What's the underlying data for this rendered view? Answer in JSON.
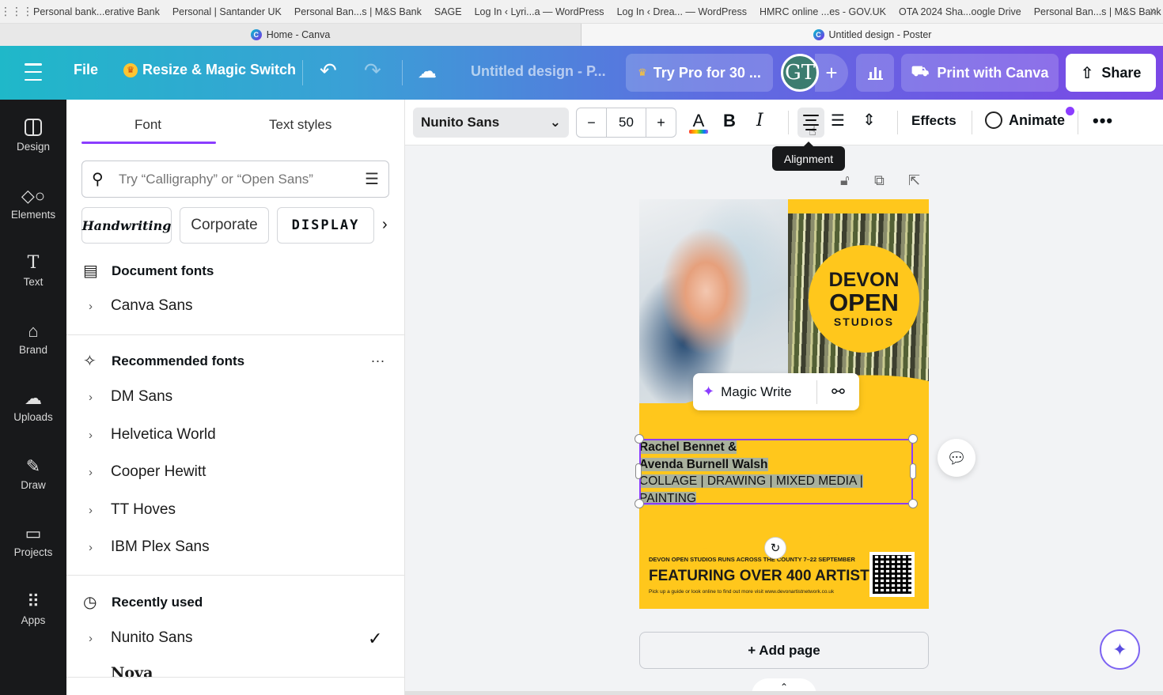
{
  "bookmarks": [
    "Personal bank...erative Bank",
    "Personal | Santander UK",
    "Personal Ban...s | M&S Bank",
    "SAGE",
    "Log In ‹ Lyri...a — WordPress",
    "Log In ‹ Drea... — WordPress",
    "HMRC online ...es - GOV.UK",
    "OTA 2024 Sha...oogle Drive",
    "Personal Ban...s | M&S Bank"
  ],
  "browser_tabs": [
    {
      "title": "Home - Canva"
    },
    {
      "title": "Untitled design - Poster"
    }
  ],
  "topbar": {
    "file": "File",
    "resize": "Resize & Magic Switch",
    "title": "Untitled design - P...",
    "try_pro": "Try Pro for 30 ...",
    "avatar_initials": "GT",
    "print": "Print with Canva",
    "share": "Share"
  },
  "rail": [
    {
      "label": "Design",
      "icon": "design-icon"
    },
    {
      "label": "Elements",
      "icon": "elements-icon"
    },
    {
      "label": "Text",
      "icon": "text-icon"
    },
    {
      "label": "Brand",
      "icon": "brand-icon"
    },
    {
      "label": "Uploads",
      "icon": "uploads-icon"
    },
    {
      "label": "Draw",
      "icon": "draw-icon"
    },
    {
      "label": "Projects",
      "icon": "projects-icon"
    },
    {
      "label": "Apps",
      "icon": "apps-icon"
    }
  ],
  "panel": {
    "tabs": [
      "Font",
      "Text styles"
    ],
    "search_placeholder": "Try “Calligraphy” or “Open Sans”",
    "chips": [
      "Handwriting",
      "Corporate",
      "DISPLAY"
    ],
    "document_fonts": {
      "title": "Document fonts",
      "fonts": [
        "Canva Sans"
      ]
    },
    "recommended": {
      "title": "Recommended fonts",
      "more": "...",
      "fonts": [
        "DM Sans",
        "Helvetica World",
        "Cooper Hewitt",
        "TT Hoves",
        "IBM Plex Sans"
      ]
    },
    "recent": {
      "title": "Recently used",
      "fonts": [
        "Nunito Sans",
        "Nova"
      ]
    }
  },
  "toolbar": {
    "font": "Nunito Sans",
    "size": "50",
    "minus": "−",
    "plus": "+",
    "bold": "B",
    "italic": "I",
    "effects": "Effects",
    "animate": "Animate",
    "more": "•••",
    "tooltip": "Alignment"
  },
  "poster": {
    "badge": [
      "DEVON",
      "OPEN",
      "STUDIOS"
    ],
    "text_lines": [
      "Rachel Bennet &",
      "Avenda Burnell Walsh",
      "COLLAGE | DRAWING | MIXED MEDIA |",
      "PAINTING"
    ],
    "runs": "DEVON OPEN STUDIOS RUNS ACROSS THE COUNTY 7–22 SEPTEMBER",
    "featuring": "FEATURING OVER 400 ARTISTS",
    "pickup": "Pick up a guide or look online to find out more visit www.devonartistnetwork.co.uk",
    "colors": {
      "background": "#ffc71c",
      "selection": "#8b3dff"
    }
  },
  "magic_write": "Magic Write",
  "add_page": "+ Add page"
}
